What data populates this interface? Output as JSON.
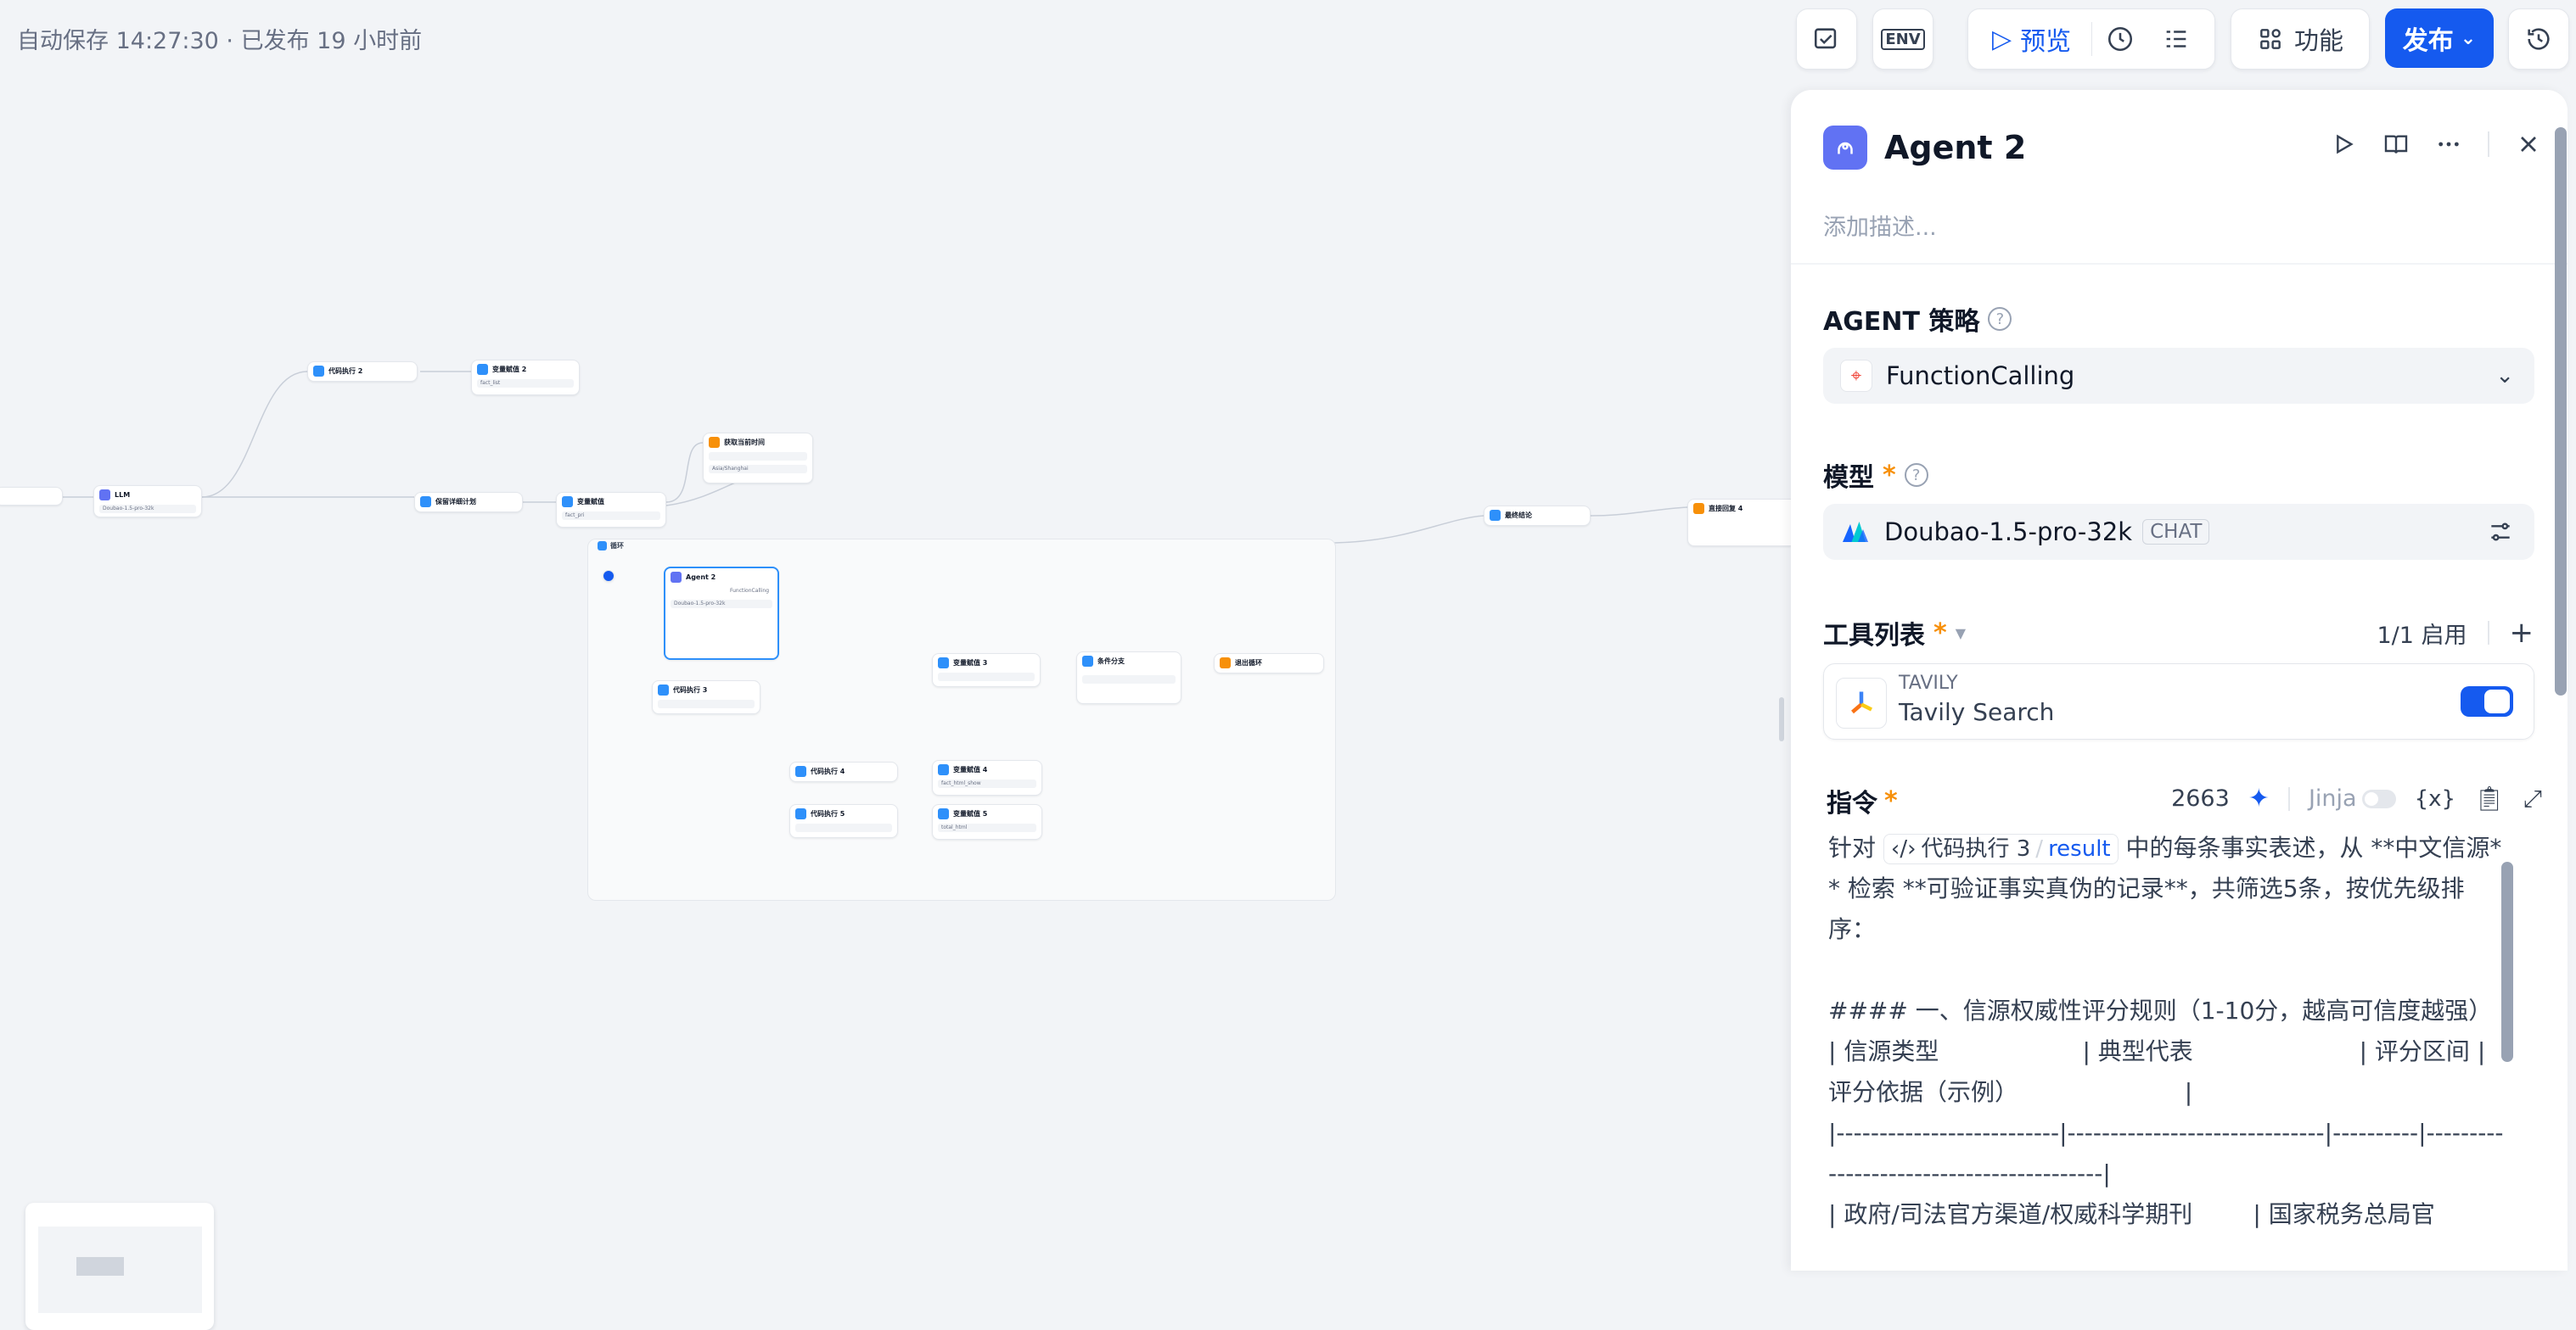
{
  "header": {
    "status": "自动保存 14:27:30 · 已发布 19 小时前",
    "env_label": "ENV",
    "preview_label": "预览",
    "feature_label": "功能",
    "publish_label": "发布"
  },
  "nodes": [
    {
      "title": "LLM",
      "row": "Doubao-1.5-pro-32k"
    },
    {
      "title": "代码执行 2",
      "row": ""
    },
    {
      "title": "变量赋值 2",
      "row": "fact_list"
    },
    {
      "title": "保留详细计划",
      "row": ""
    },
    {
      "title": "变量赋值",
      "row": "fact_pri"
    },
    {
      "title": "获取当前时间",
      "row": "Asia/Shanghai"
    },
    {
      "title": "循环",
      "row": ""
    },
    {
      "title": "Agent 2",
      "row": "FunctionCalling"
    },
    {
      "title": "代码执行 3",
      "row": ""
    },
    {
      "title": "变量赋值 3",
      "row": ""
    },
    {
      "title": "条件分支",
      "row": ""
    },
    {
      "title": "退出循环",
      "row": ""
    },
    {
      "title": "代码执行 4",
      "row": ""
    },
    {
      "title": "变量赋值 4",
      "row": "fact_html_show"
    },
    {
      "title": "代码执行 5",
      "row": ""
    },
    {
      "title": "变量赋值 5",
      "row": "total_html"
    },
    {
      "title": "最终结论",
      "row": ""
    },
    {
      "title": "直接回复 4",
      "row": ""
    }
  ],
  "panel": {
    "title": "Agent 2",
    "description_placeholder": "添加描述...",
    "strategy_label": "AGENT 策略",
    "strategy_value": "FunctionCalling",
    "model_label": "模型",
    "model_value": "Doubao-1.5-pro-32k",
    "model_badge": "CHAT",
    "tools_label": "工具列表",
    "tools_enabled": "1/1 启用",
    "tool": {
      "provider": "TAVILY",
      "name": "Tavily Search"
    },
    "instruction_label": "指令",
    "instruction_count": "2663",
    "jinja_label": "Jinja",
    "ref_node": "代码执行 3",
    "ref_var": "result",
    "instruction_pre": "针对",
    "instruction_text": " 中的每条事实表述，从 **中文信源** 检索 **可验证事实真伪的记录**，共筛选5条，按优先级排序：\n\n#### 一、信源权威性评分规则（1-10分，越高可信度越强）\n| 信源类型                   | 典型代表                      | 评分区间 | 评分依据（示例）                      |\n|--------------------------|------------------------------|----------|-----------------------------------------|\n| 政府/司法官方渠道/权威科学期刊        | 国家税务总局官"
  },
  "colors": {
    "accent": "#155aef",
    "star": "#f79009",
    "agent_icon": "#6172f3"
  }
}
